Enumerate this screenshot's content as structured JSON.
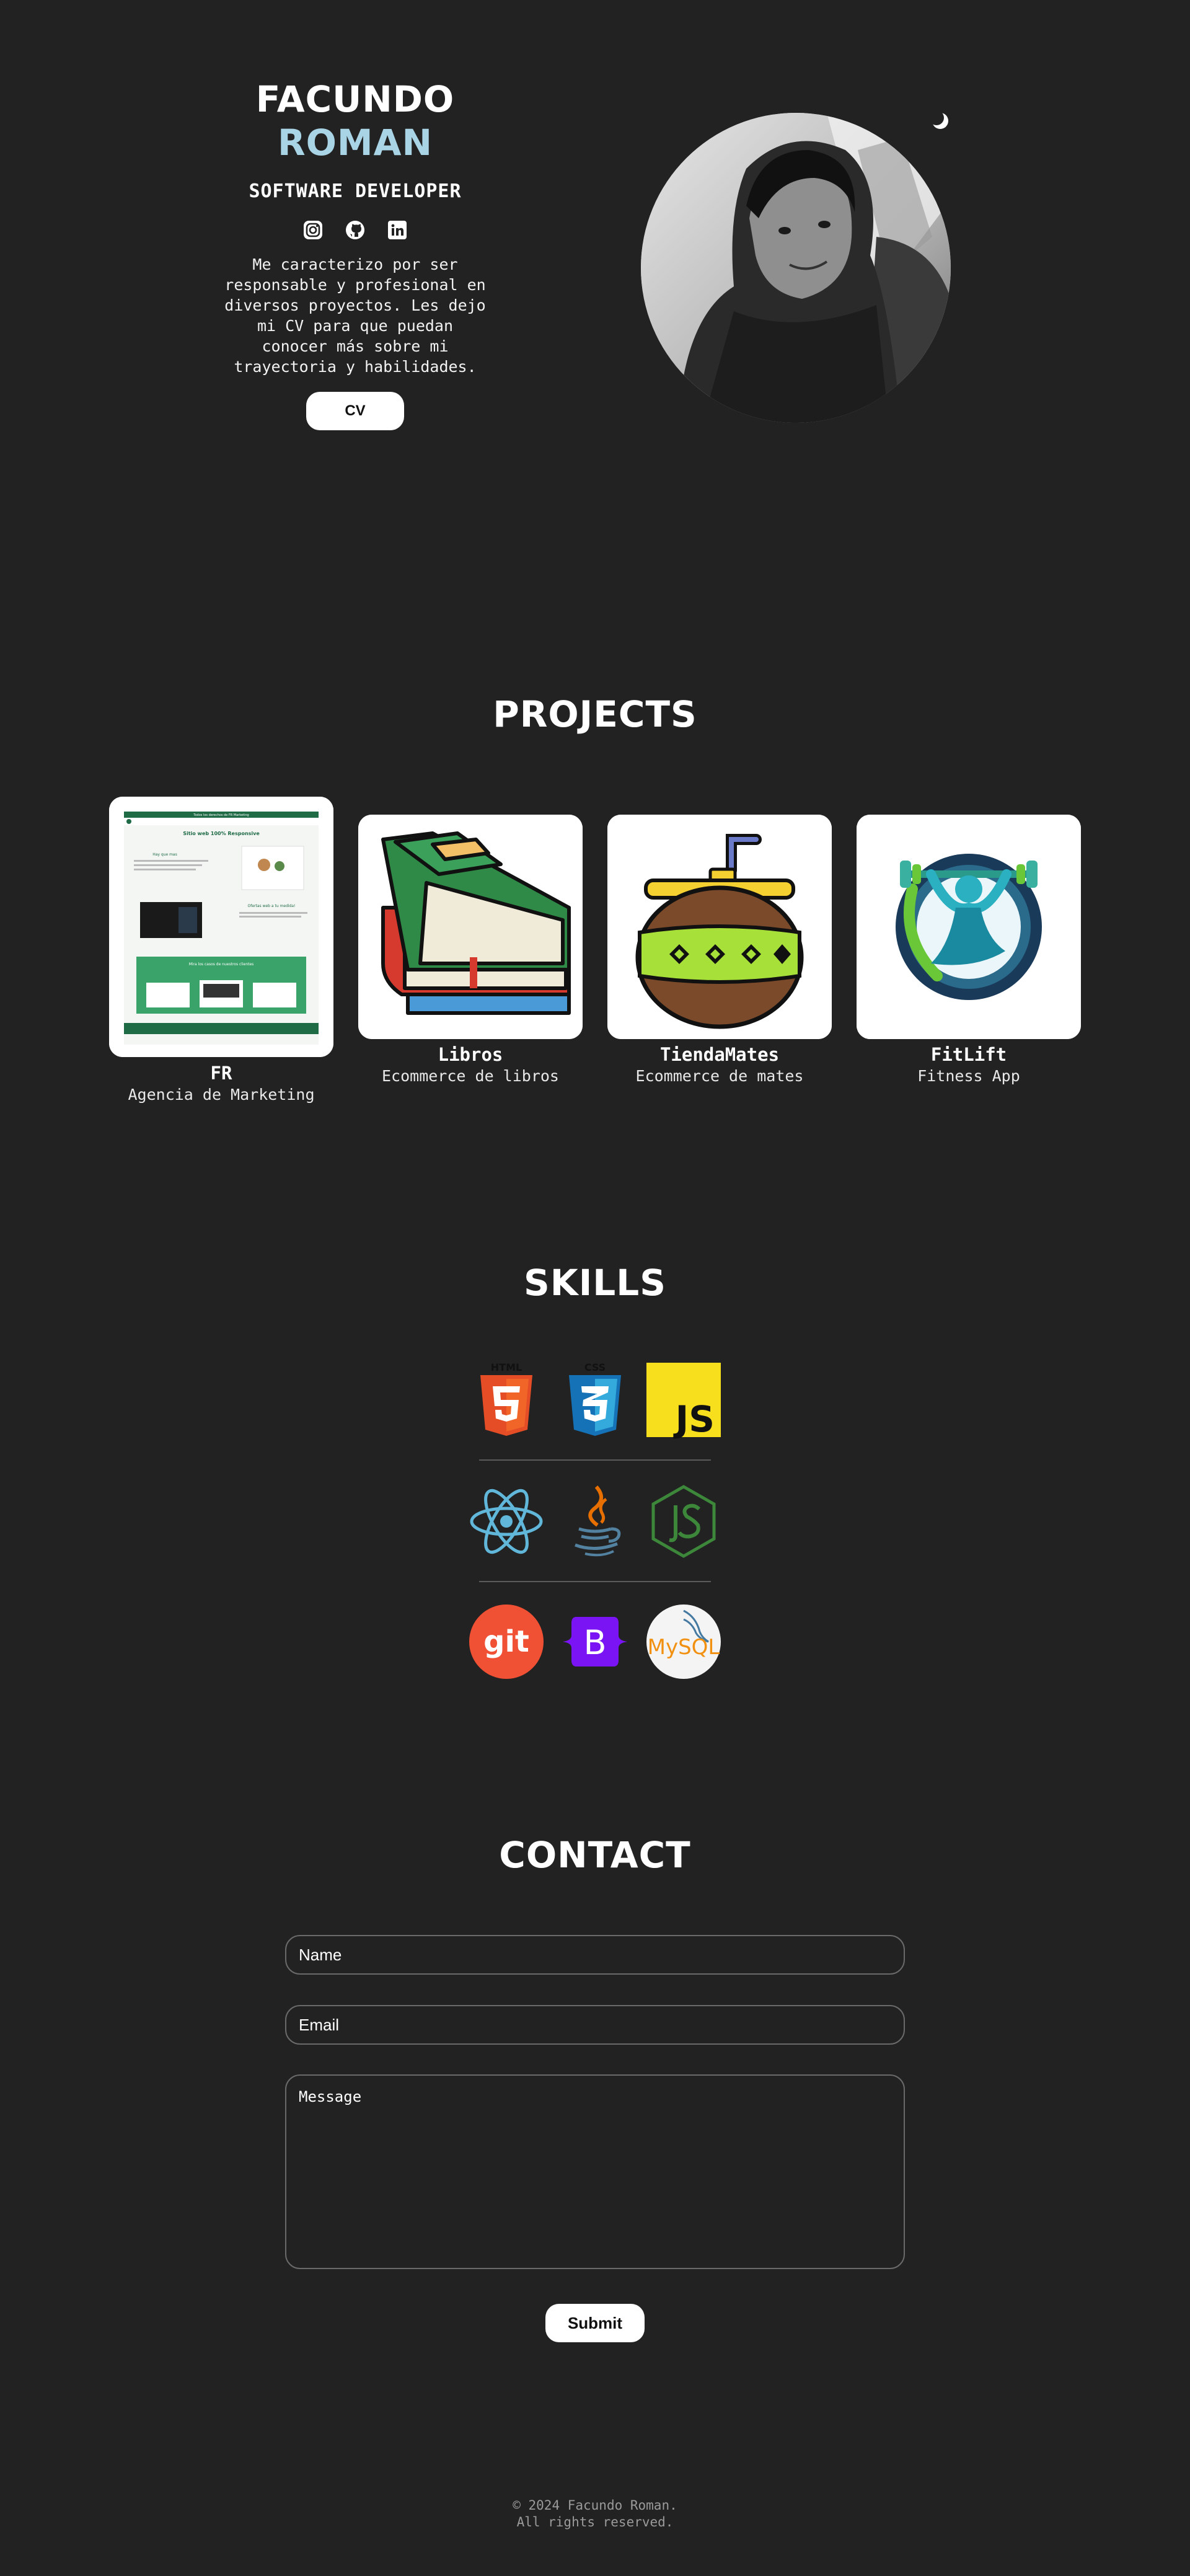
{
  "hero": {
    "first_name": "FACUNDO",
    "last_name": "ROMAN",
    "role": "SOFTWARE DEVELOPER",
    "bio": "Me caracterizo por ser responsable y profesional en diversos proyectos. Les dejo mi CV para que puedan conocer más sobre mi trayectoria y habilidades.",
    "cv_label": "CV",
    "socials": [
      "instagram-icon",
      "github-icon",
      "linkedin-icon"
    ],
    "name_accent_color": "#a9d4e6"
  },
  "projects": {
    "title": "PROJECTS",
    "items": [
      {
        "name": "FR",
        "description": "Agencia de Marketing"
      },
      {
        "name": "Libros",
        "description": "Ecommerce de libros"
      },
      {
        "name": "TiendaMates",
        "description": "Ecommerce de mates"
      },
      {
        "name": "FitLift",
        "description": "Fitness App"
      }
    ],
    "fr_preview": {
      "banner": "Todos los derechos de FR Marketing",
      "heading": "Sitio web 100% Responsive",
      "subheading": "Hay que mas",
      "offer_title": "Ofertas web a tu medida!",
      "cta_title": "Mira los casos de nuestros clientes"
    }
  },
  "skills": {
    "title": "SKILLS",
    "rows": [
      [
        "html5-icon",
        "css3-icon",
        "javascript-icon"
      ],
      [
        "react-icon",
        "java-icon",
        "nodejs-icon"
      ],
      [
        "git-icon",
        "bootstrap-icon",
        "mysql-icon"
      ]
    ],
    "labels": {
      "html": "HTML",
      "css": "CSS",
      "js": "JS",
      "git": "git",
      "bootstrap": "B",
      "mysql": "MySQL"
    }
  },
  "contact": {
    "title": "CONTACT",
    "name_placeholder": "Name",
    "email_placeholder": "Email",
    "message_placeholder": "Message",
    "submit_label": "Submit"
  },
  "footer": {
    "line1": "© 2024 Facundo Roman.",
    "line2": "All rights reserved."
  },
  "colors": {
    "background": "#222222",
    "text": "#ffffff",
    "button": "#ffffff"
  }
}
